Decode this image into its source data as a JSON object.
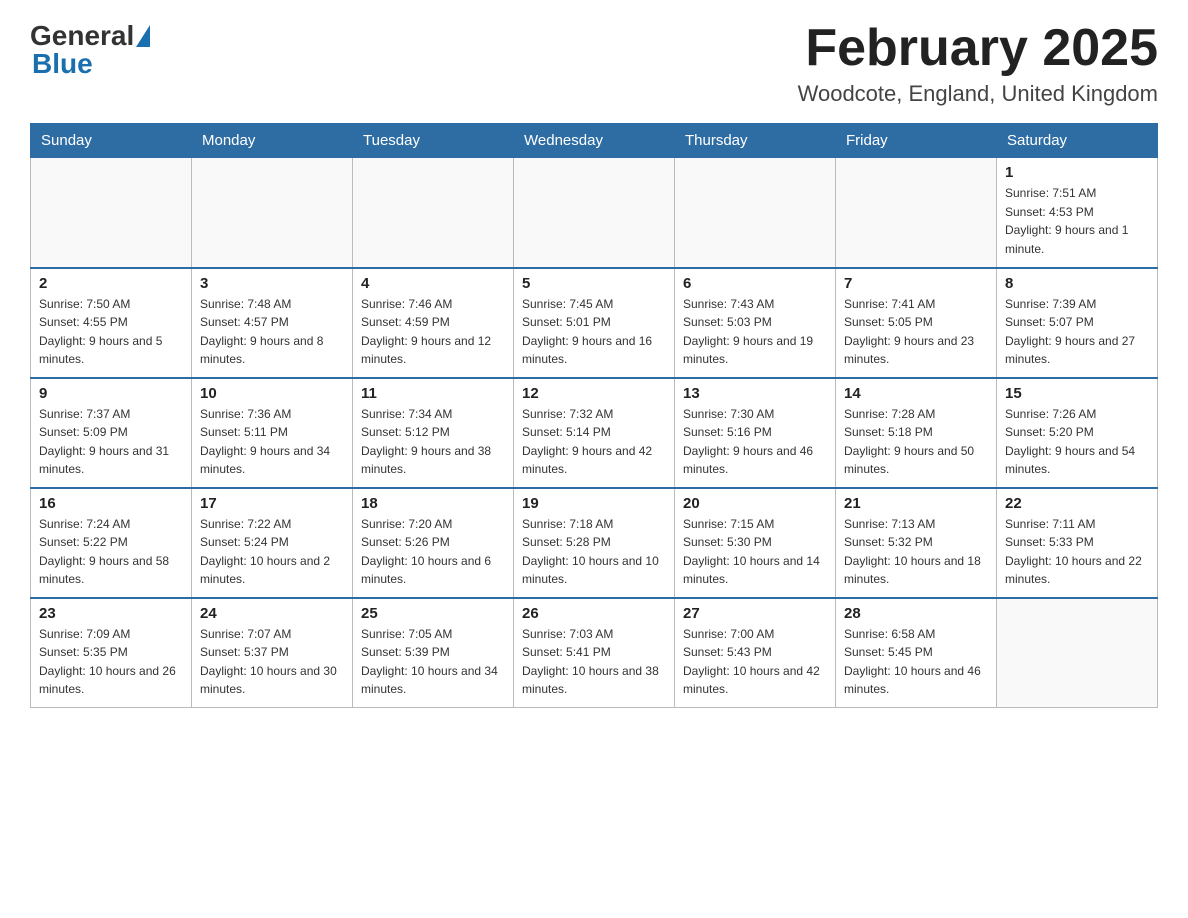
{
  "header": {
    "logo_general": "General",
    "logo_blue": "Blue",
    "month_title": "February 2025",
    "location": "Woodcote, England, United Kingdom"
  },
  "days_of_week": [
    "Sunday",
    "Monday",
    "Tuesday",
    "Wednesday",
    "Thursday",
    "Friday",
    "Saturday"
  ],
  "weeks": [
    [
      {
        "day": "",
        "info": ""
      },
      {
        "day": "",
        "info": ""
      },
      {
        "day": "",
        "info": ""
      },
      {
        "day": "",
        "info": ""
      },
      {
        "day": "",
        "info": ""
      },
      {
        "day": "",
        "info": ""
      },
      {
        "day": "1",
        "info": "Sunrise: 7:51 AM\nSunset: 4:53 PM\nDaylight: 9 hours and 1 minute."
      }
    ],
    [
      {
        "day": "2",
        "info": "Sunrise: 7:50 AM\nSunset: 4:55 PM\nDaylight: 9 hours and 5 minutes."
      },
      {
        "day": "3",
        "info": "Sunrise: 7:48 AM\nSunset: 4:57 PM\nDaylight: 9 hours and 8 minutes."
      },
      {
        "day": "4",
        "info": "Sunrise: 7:46 AM\nSunset: 4:59 PM\nDaylight: 9 hours and 12 minutes."
      },
      {
        "day": "5",
        "info": "Sunrise: 7:45 AM\nSunset: 5:01 PM\nDaylight: 9 hours and 16 minutes."
      },
      {
        "day": "6",
        "info": "Sunrise: 7:43 AM\nSunset: 5:03 PM\nDaylight: 9 hours and 19 minutes."
      },
      {
        "day": "7",
        "info": "Sunrise: 7:41 AM\nSunset: 5:05 PM\nDaylight: 9 hours and 23 minutes."
      },
      {
        "day": "8",
        "info": "Sunrise: 7:39 AM\nSunset: 5:07 PM\nDaylight: 9 hours and 27 minutes."
      }
    ],
    [
      {
        "day": "9",
        "info": "Sunrise: 7:37 AM\nSunset: 5:09 PM\nDaylight: 9 hours and 31 minutes."
      },
      {
        "day": "10",
        "info": "Sunrise: 7:36 AM\nSunset: 5:11 PM\nDaylight: 9 hours and 34 minutes."
      },
      {
        "day": "11",
        "info": "Sunrise: 7:34 AM\nSunset: 5:12 PM\nDaylight: 9 hours and 38 minutes."
      },
      {
        "day": "12",
        "info": "Sunrise: 7:32 AM\nSunset: 5:14 PM\nDaylight: 9 hours and 42 minutes."
      },
      {
        "day": "13",
        "info": "Sunrise: 7:30 AM\nSunset: 5:16 PM\nDaylight: 9 hours and 46 minutes."
      },
      {
        "day": "14",
        "info": "Sunrise: 7:28 AM\nSunset: 5:18 PM\nDaylight: 9 hours and 50 minutes."
      },
      {
        "day": "15",
        "info": "Sunrise: 7:26 AM\nSunset: 5:20 PM\nDaylight: 9 hours and 54 minutes."
      }
    ],
    [
      {
        "day": "16",
        "info": "Sunrise: 7:24 AM\nSunset: 5:22 PM\nDaylight: 9 hours and 58 minutes."
      },
      {
        "day": "17",
        "info": "Sunrise: 7:22 AM\nSunset: 5:24 PM\nDaylight: 10 hours and 2 minutes."
      },
      {
        "day": "18",
        "info": "Sunrise: 7:20 AM\nSunset: 5:26 PM\nDaylight: 10 hours and 6 minutes."
      },
      {
        "day": "19",
        "info": "Sunrise: 7:18 AM\nSunset: 5:28 PM\nDaylight: 10 hours and 10 minutes."
      },
      {
        "day": "20",
        "info": "Sunrise: 7:15 AM\nSunset: 5:30 PM\nDaylight: 10 hours and 14 minutes."
      },
      {
        "day": "21",
        "info": "Sunrise: 7:13 AM\nSunset: 5:32 PM\nDaylight: 10 hours and 18 minutes."
      },
      {
        "day": "22",
        "info": "Sunrise: 7:11 AM\nSunset: 5:33 PM\nDaylight: 10 hours and 22 minutes."
      }
    ],
    [
      {
        "day": "23",
        "info": "Sunrise: 7:09 AM\nSunset: 5:35 PM\nDaylight: 10 hours and 26 minutes."
      },
      {
        "day": "24",
        "info": "Sunrise: 7:07 AM\nSunset: 5:37 PM\nDaylight: 10 hours and 30 minutes."
      },
      {
        "day": "25",
        "info": "Sunrise: 7:05 AM\nSunset: 5:39 PM\nDaylight: 10 hours and 34 minutes."
      },
      {
        "day": "26",
        "info": "Sunrise: 7:03 AM\nSunset: 5:41 PM\nDaylight: 10 hours and 38 minutes."
      },
      {
        "day": "27",
        "info": "Sunrise: 7:00 AM\nSunset: 5:43 PM\nDaylight: 10 hours and 42 minutes."
      },
      {
        "day": "28",
        "info": "Sunrise: 6:58 AM\nSunset: 5:45 PM\nDaylight: 10 hours and 46 minutes."
      },
      {
        "day": "",
        "info": ""
      }
    ]
  ]
}
